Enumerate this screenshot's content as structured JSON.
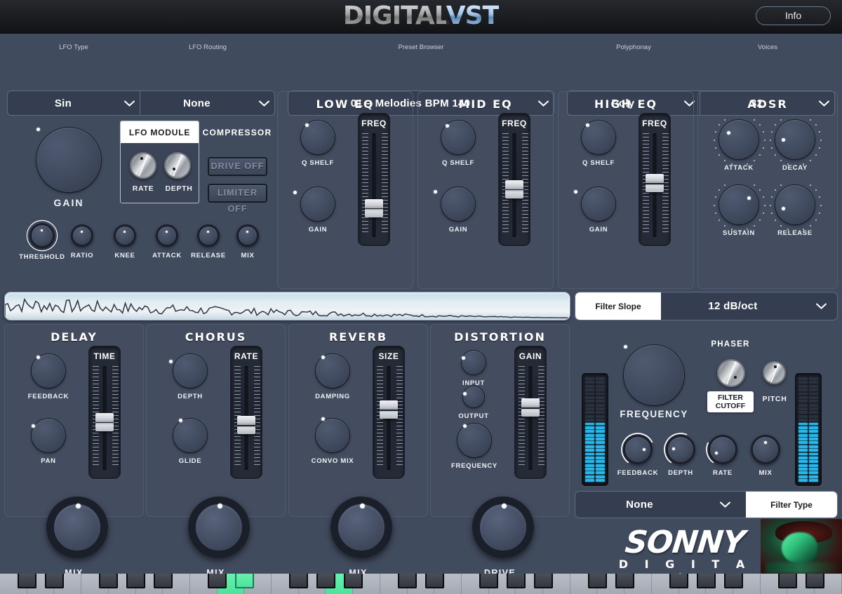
{
  "header": {
    "logo_primary": "DIGITAL",
    "logo_secondary": "VST",
    "info_label": "Info"
  },
  "topbar": {
    "lfo_type": {
      "label": "LFO Type",
      "value": "Sin"
    },
    "lfo_routing": {
      "label": "LFO Routing",
      "value": "None"
    },
    "preset_browser": {
      "label": "Preset Browser",
      "value": "01 – Melodies BPM 140"
    },
    "polyphony": {
      "label": "Polyphonay",
      "value": "Poly"
    },
    "voices": {
      "label": "Voices",
      "value": "32"
    }
  },
  "master": {
    "gain_label": "GAIN",
    "lfo_module": {
      "title": "LFO MODULE",
      "rate_label": "RATE",
      "depth_label": "DEPTH"
    },
    "compressor": {
      "title": "COMPRESSOR",
      "drive_label": "DRIVE OFF",
      "limiter_label": "LIMITER OFF",
      "knobs": [
        "THRESHOLD",
        "RATIO",
        "KNEE",
        "ATTACK",
        "RELEASE",
        "MIX"
      ]
    }
  },
  "eq": [
    {
      "title": "LOW EQ",
      "q_label": "Q SHELF",
      "gain_label": "GAIN",
      "fader_label": "FREQ"
    },
    {
      "title": "MID EQ",
      "q_label": "Q SHELF",
      "gain_label": "GAIN",
      "fader_label": "FREQ"
    },
    {
      "title": "HIGH EQ",
      "q_label": "Q SHELF",
      "gain_label": "GAIN",
      "fader_label": "FREQ"
    }
  ],
  "adsr": {
    "title": "ADSR",
    "knobs": [
      "ATTACK",
      "DECAY",
      "SUSTAIN",
      "RELEASE"
    ]
  },
  "filter_slope": {
    "label": "Filter Slope",
    "value": "12 dB/oct"
  },
  "effects": [
    {
      "title": "DELAY",
      "knob1": "FEEDBACK",
      "knob2": "PAN",
      "fader_label": "TIME",
      "mix_label": "MIX"
    },
    {
      "title": "CHORUS",
      "knob1": "DEPTH",
      "knob2": "GLIDE",
      "fader_label": "RATE",
      "mix_label": "MIX"
    },
    {
      "title": "REVERB",
      "knob1": "DAMPING",
      "knob2": "CONVO MIX",
      "fader_label": "SIZE",
      "mix_label": "MIX"
    },
    {
      "title": "DISTORTION",
      "knob1": "INPUT",
      "knob2": "OUTPUT",
      "knob3": "FREQUENCY",
      "fader_label": "GAIN",
      "mix_label": "DRIVE"
    }
  ],
  "right_panel": {
    "frequency_label": "FREQUENCY",
    "phaser_title": "PHASER",
    "filter_cutoff_label": "FILTER CUTOFF",
    "pitch_label": "PITCH",
    "phaser_knobs": [
      "FEEDBACK",
      "DEPTH",
      "RATE",
      "MIX"
    ],
    "filter_type": {
      "label": "Filter Type",
      "value": "None"
    }
  },
  "brand": {
    "name": "SONNY",
    "sub": "D I G I T A L"
  },
  "colors": {
    "background": "#414b5e",
    "header": "#1b1d21",
    "panel_border": "#525c70",
    "accent_cyan": "#29b6e8",
    "key_active": "#4ce39c",
    "select_bg": "#353e50",
    "text": "#ffffff"
  },
  "keyboard": {
    "white_key_count": 31,
    "active_white_keys": [
      8,
      12
    ],
    "active_black_keys": [
      6
    ]
  }
}
